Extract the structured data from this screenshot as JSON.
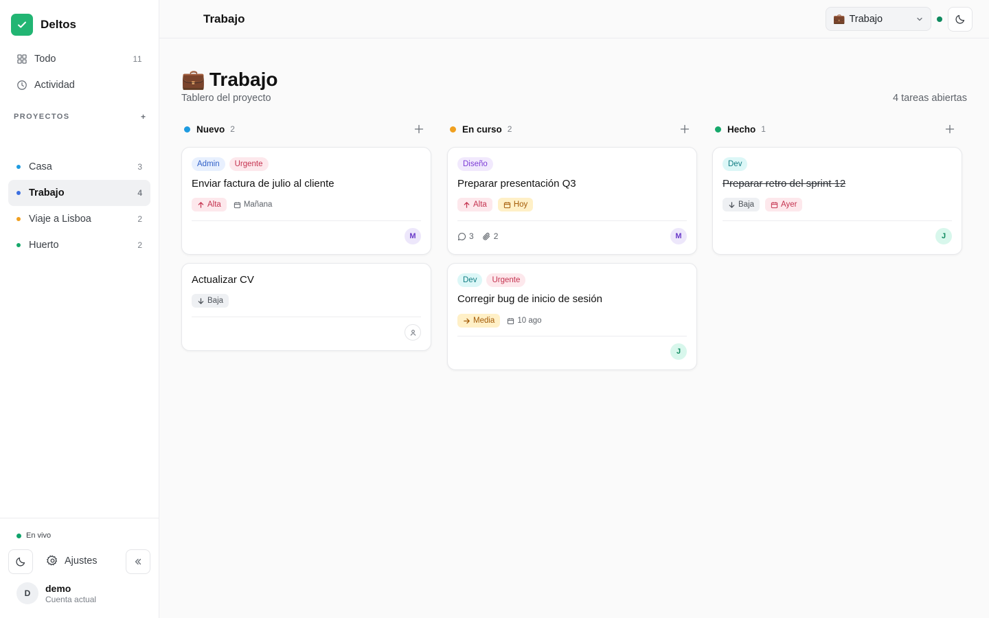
{
  "app": {
    "name": "Deltos"
  },
  "sidebar": {
    "nav": [
      {
        "label": "Todo",
        "count": "11",
        "icon": "grid-icon"
      },
      {
        "label": "Actividad",
        "count": "",
        "icon": "clock-icon"
      }
    ],
    "projects_heading": "PROYECTOS",
    "projects_add": "+",
    "projects": [
      {
        "label": "Casa",
        "count": "3",
        "color": "#1e9be0"
      },
      {
        "label": "Trabajo",
        "count": "4",
        "color": "#3b6fe0",
        "active": true
      },
      {
        "label": "Viaje a Lisboa",
        "count": "2",
        "color": "#f0a020"
      },
      {
        "label": "Huerto",
        "count": "2",
        "color": "#16a86b"
      }
    ],
    "live_label": "En vivo",
    "settings_label": "Ajustes",
    "user": {
      "initial": "D",
      "name": "demo",
      "subtitle": "Cuenta actual"
    }
  },
  "header": {
    "title": "Trabajo",
    "project_select": {
      "emoji": "💼",
      "value": "Trabajo"
    }
  },
  "page": {
    "emoji": "💼",
    "title": "Trabajo",
    "subtitle": "Tablero del proyecto",
    "open_count": "4 tareas abiertas"
  },
  "columns": [
    {
      "name": "Nuevo",
      "count": "2",
      "color": "#1e9be0",
      "cards": [
        {
          "tags": [
            "Admin",
            "Urgente"
          ],
          "title": "Enviar factura de julio al cliente",
          "priority": "Alta",
          "due": "Mañana",
          "assignee": "M"
        },
        {
          "tags": [],
          "title": "Actualizar CV",
          "priority": "Baja",
          "assignee": ""
        }
      ]
    },
    {
      "name": "En curso",
      "count": "2",
      "color": "#f0a020",
      "cards": [
        {
          "tags": [
            "Diseño"
          ],
          "title": "Preparar presentación Q3",
          "priority": "Alta",
          "due": "Hoy",
          "comments": "3",
          "attachments": "2",
          "assignee": "M"
        },
        {
          "tags": [
            "Dev",
            "Urgente"
          ],
          "title": "Corregir bug de inicio de sesión",
          "priority": "Media",
          "due": "10 ago",
          "assignee": "J"
        }
      ]
    },
    {
      "name": "Hecho",
      "count": "1",
      "color": "#16a86b",
      "cards": [
        {
          "tags": [
            "Dev"
          ],
          "title": "Preparar retro del sprint 12",
          "priority": "Baja",
          "due": "Ayer",
          "assignee": "J"
        }
      ]
    }
  ]
}
